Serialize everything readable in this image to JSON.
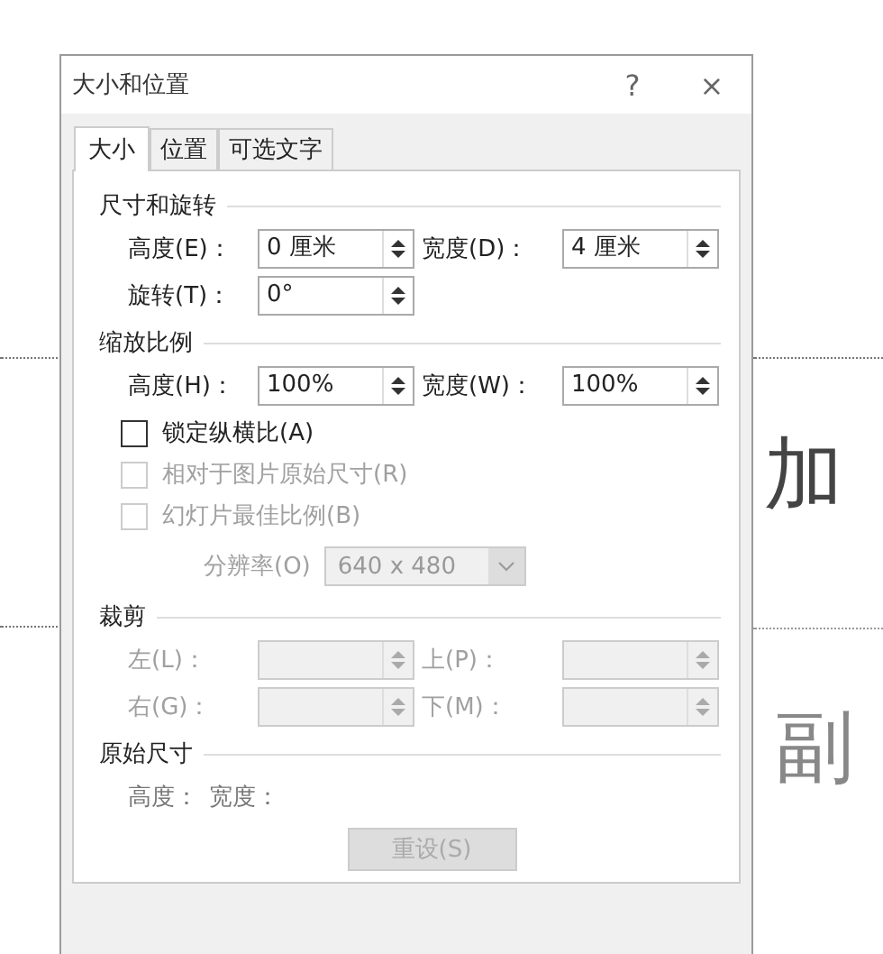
{
  "background": {
    "slide_texts": [
      "加",
      "副"
    ]
  },
  "window": {
    "title": "大小和位置",
    "help": "?",
    "close": "×"
  },
  "tabs": [
    {
      "label": "大小",
      "selected": true
    },
    {
      "label": "位置",
      "selected": false
    },
    {
      "label": "可选文字",
      "selected": false
    }
  ],
  "size_rotation": {
    "heading": "尺寸和旋转",
    "fields": [
      {
        "label": "高度(E)：",
        "value": "0 厘米",
        "disabled": false
      },
      {
        "label": "宽度(D)：",
        "value": "4 厘米",
        "disabled": false
      },
      {
        "label": "旋转(T)：",
        "value": "0°",
        "disabled": false
      }
    ]
  },
  "scale": {
    "heading": "缩放比例",
    "fields": [
      {
        "label": "高度(H)：",
        "value": "100%",
        "disabled": false
      },
      {
        "label": "宽度(W)：",
        "value": "100%",
        "disabled": false
      }
    ],
    "checkboxes": [
      {
        "label": "锁定纵横比(A)",
        "checked": false,
        "disabled": false
      },
      {
        "label": "相对于图片原始尺寸(R)",
        "checked": false,
        "disabled": true
      },
      {
        "label": "幻灯片最佳比例(B)",
        "checked": false,
        "disabled": true
      }
    ],
    "resolution": {
      "label": "分辨率(O)",
      "value": "640 x 480",
      "disabled": true
    }
  },
  "crop": {
    "heading": "裁剪",
    "fields": [
      {
        "label": "左(L)：",
        "disabled": true
      },
      {
        "label": "上(P)：",
        "disabled": true
      },
      {
        "label": "右(G)：",
        "disabled": true
      },
      {
        "label": "下(M)：",
        "disabled": true
      }
    ]
  },
  "original_size": {
    "heading": "原始尺寸",
    "labels": [
      "高度：",
      "宽度："
    ],
    "reset_button": {
      "label": "重设(S)",
      "disabled": true
    }
  }
}
